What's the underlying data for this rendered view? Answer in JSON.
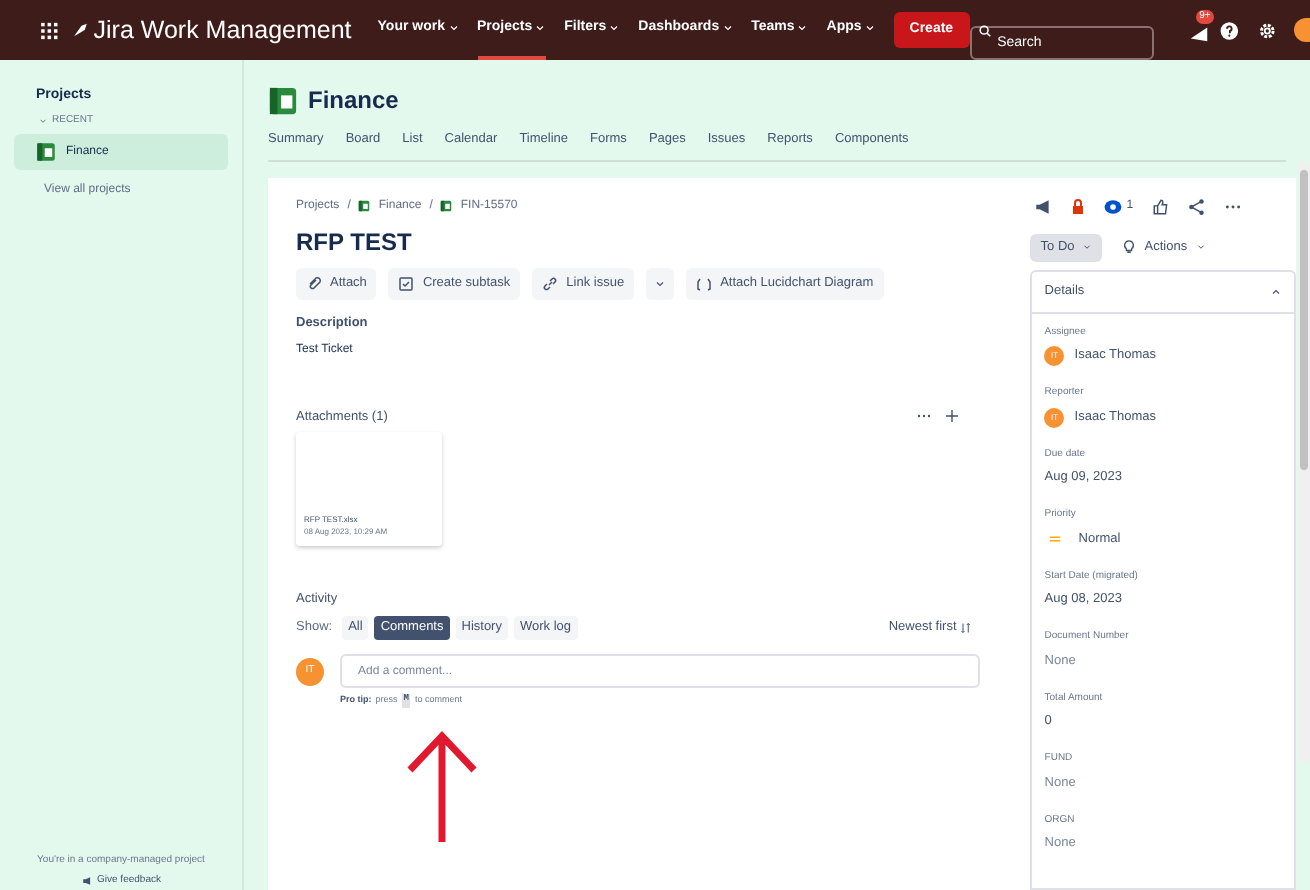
{
  "topbar": {
    "product": "Jira Work Management",
    "menus": [
      {
        "label": "Your work",
        "selected": false
      },
      {
        "label": "Projects",
        "selected": true
      },
      {
        "label": "Filters",
        "selected": false
      },
      {
        "label": "Dashboards",
        "selected": false
      },
      {
        "label": "Teams",
        "selected": false
      },
      {
        "label": "Apps",
        "selected": false
      }
    ],
    "create": "Create",
    "search": {
      "placeholder": "Search"
    },
    "notifications": "9+"
  },
  "sidebar": {
    "heading": "Projects",
    "section": "RECENT",
    "items": [
      {
        "label": "Finance",
        "selected": true
      }
    ],
    "view_all": "View all projects",
    "footer": "You're in a company-managed project",
    "feedback": "Give feedback"
  },
  "project": {
    "name": "Finance",
    "tabs": [
      {
        "label": "Summary",
        "selected": false
      },
      {
        "label": "Board",
        "selected": false
      },
      {
        "label": "List",
        "selected": false
      },
      {
        "label": "Calendar",
        "selected": false
      },
      {
        "label": "Timeline",
        "selected": false
      },
      {
        "label": "Forms",
        "selected": false
      },
      {
        "label": "Pages",
        "selected": false
      },
      {
        "label": "Issues",
        "selected": false
      },
      {
        "label": "Reports",
        "selected": false
      },
      {
        "label": "Components",
        "selected": false
      }
    ]
  },
  "issue": {
    "breadcrumbs": [
      "Projects",
      "Finance",
      "FIN-15570"
    ],
    "breadcrumb_separator": "/",
    "title": "RFP TEST",
    "actions": [
      {
        "kind": "attach",
        "label": "Attach"
      },
      {
        "kind": "subtask",
        "label": "Create subtask"
      },
      {
        "kind": "link",
        "label": "Link issue"
      },
      {
        "kind": "more"
      },
      {
        "kind": "lucid",
        "label": "Attach Lucidchart Diagram"
      }
    ],
    "description_label": "Description",
    "description": "Test Ticket",
    "attachments_label": "Attachments (1)",
    "attachments": [
      {
        "name": "RFP TEST.xlsx",
        "date": "08 Aug 2023, 10:29 AM"
      }
    ],
    "activity": {
      "label": "Activity",
      "show": "Show:",
      "filters": [
        {
          "label": "All",
          "selected": false
        },
        {
          "label": "Comments",
          "selected": true
        },
        {
          "label": "History",
          "selected": false
        },
        {
          "label": "Work log",
          "selected": false
        }
      ],
      "sort": "Newest first",
      "avatar": "IT",
      "placeholder": "Add a comment...",
      "tip_bold": "Pro tip:",
      "tip_a": "press",
      "tip_key": "M",
      "tip_b": "to comment"
    }
  },
  "side": {
    "watchers": "1",
    "status": "To Do",
    "actions": "Actions",
    "details": "Details",
    "fields": [
      {
        "label": "Assignee",
        "kind": "user",
        "initials": "IT",
        "value": "Isaac Thomas"
      },
      {
        "label": "Reporter",
        "kind": "user",
        "initials": "IT",
        "value": "Isaac Thomas"
      },
      {
        "label": "Due date",
        "kind": "text",
        "value": "Aug 09, 2023"
      },
      {
        "label": "Priority",
        "kind": "priority",
        "value": "Normal"
      },
      {
        "label": "Start Date (migrated)",
        "kind": "text",
        "value": "Aug 08, 2023"
      },
      {
        "label": "Document Number",
        "kind": "muted",
        "value": "None"
      },
      {
        "label": "Total Amount",
        "kind": "text",
        "value": "0"
      },
      {
        "label": "FUND",
        "kind": "muted",
        "value": "None"
      },
      {
        "label": "ORGN",
        "kind": "muted",
        "value": "None"
      }
    ]
  }
}
